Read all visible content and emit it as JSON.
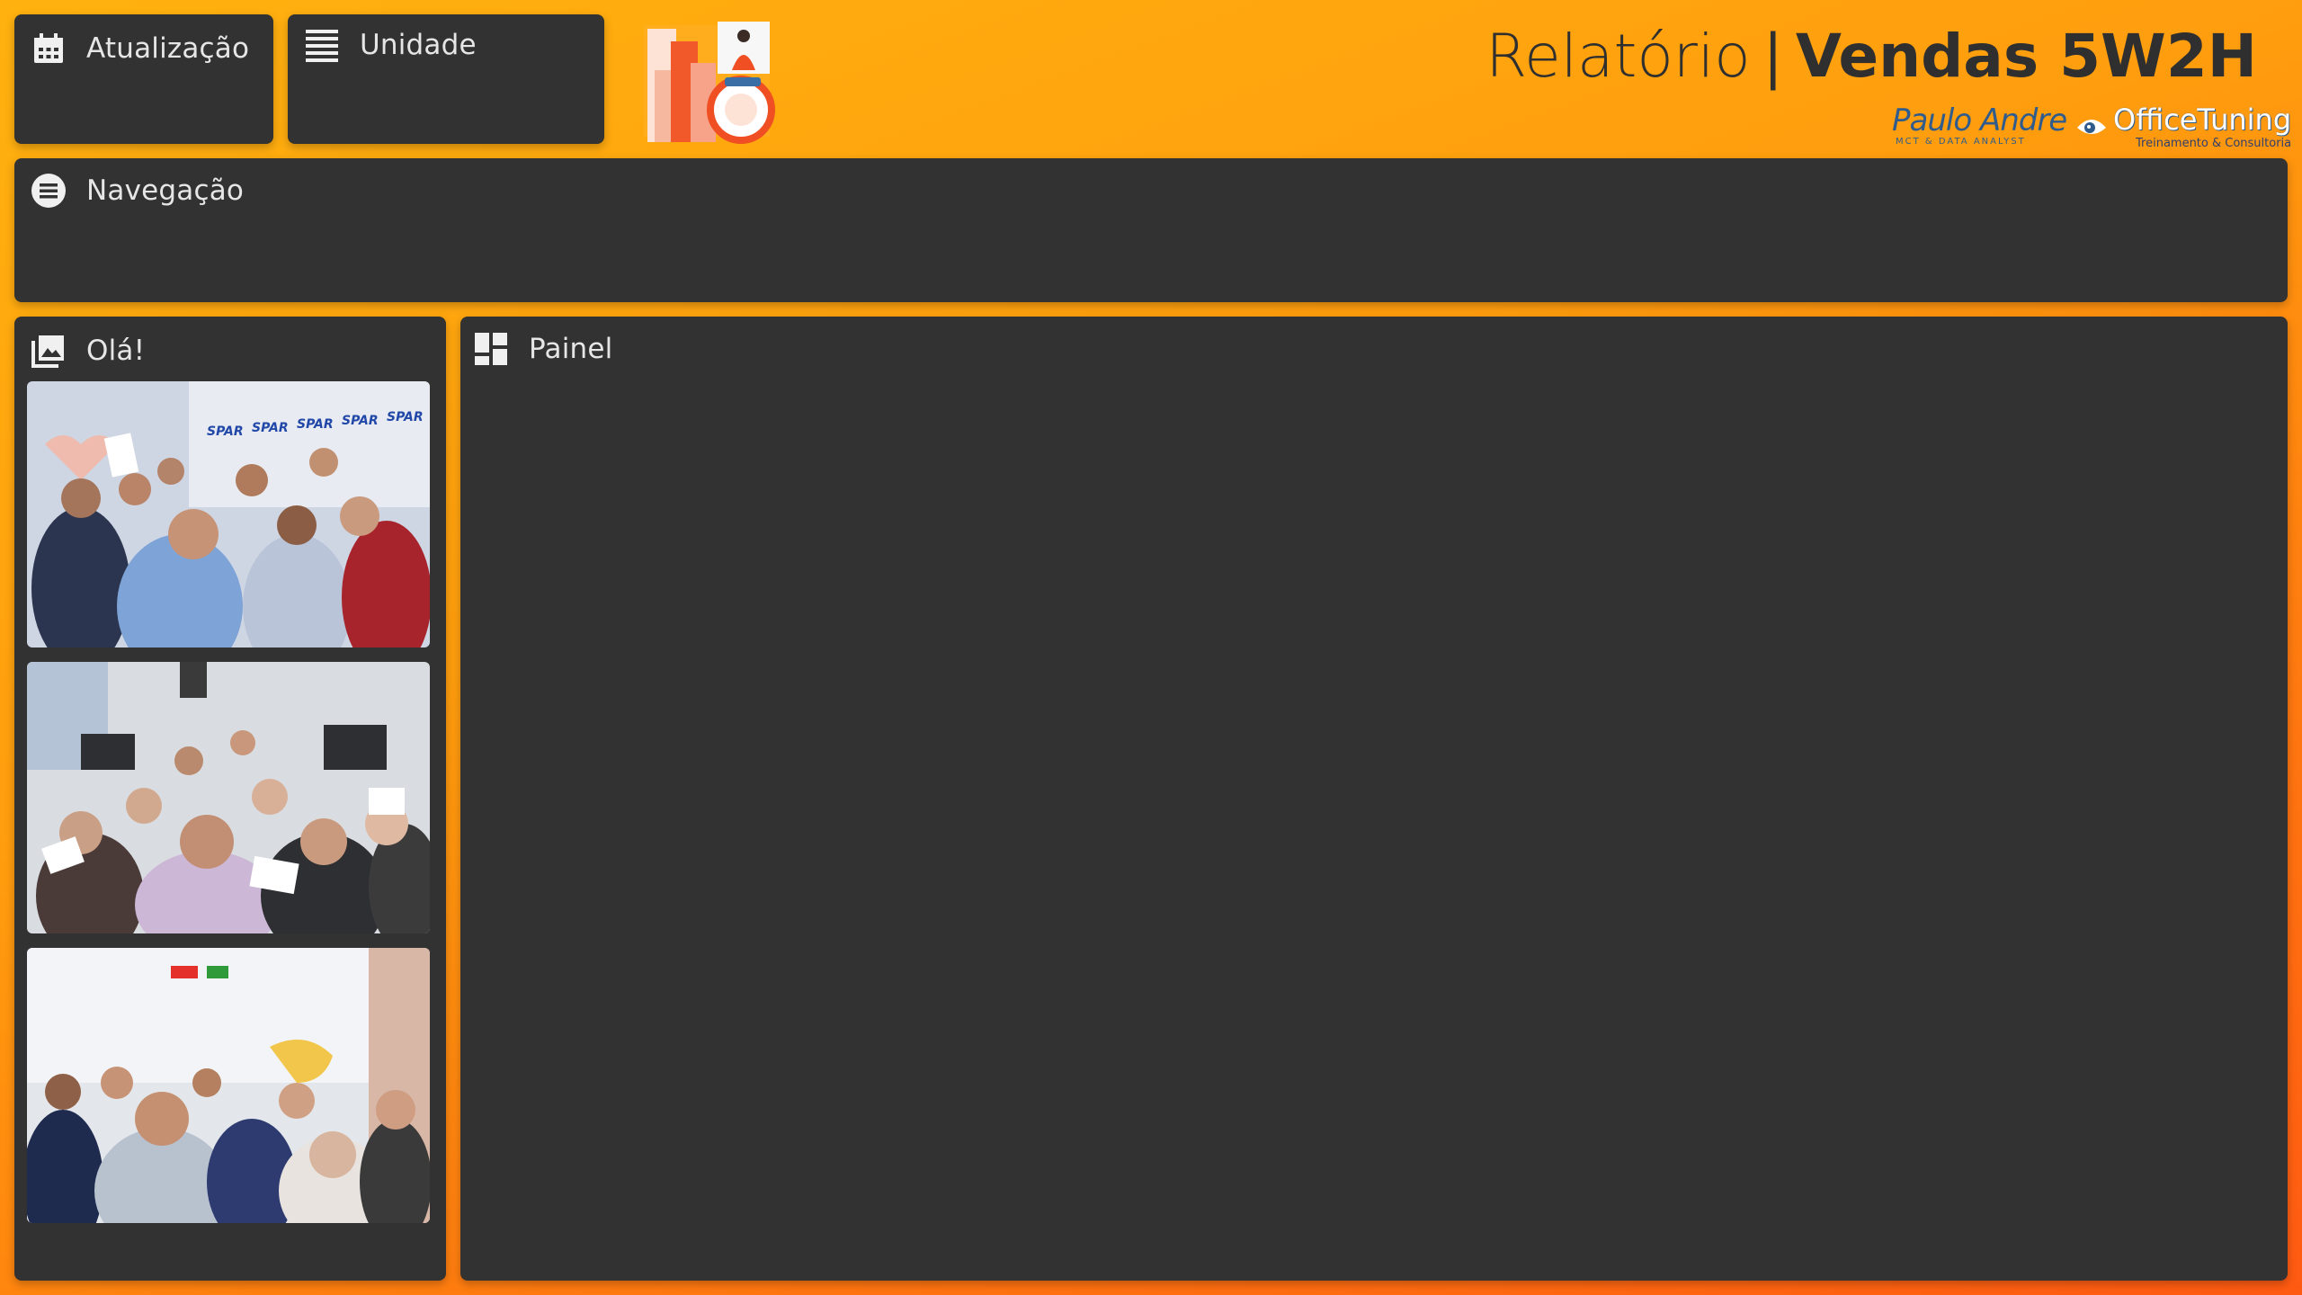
{
  "header": {
    "title_light": "Relatório",
    "title_sep": "|",
    "title_bold": "Vendas 5W2H",
    "signature_name": "Paulo Andre",
    "signature_sub": "MCT & DATA ANALYST",
    "brand_name": "OfficeTuning",
    "brand_sub": "Treinamento & Consultoria"
  },
  "cards": {
    "atualizacao": {
      "label": "Atualização",
      "icon": "calendar-icon"
    },
    "unidade": {
      "label": "Unidade",
      "icon": "list-lines-icon"
    },
    "navegacao": {
      "label": "Navegação",
      "icon": "menu-circle-icon"
    },
    "ola": {
      "label": "Olá!",
      "icon": "image-gallery-icon"
    },
    "painel": {
      "label": "Painel",
      "icon": "dashboard-icon"
    }
  },
  "photos": [
    {
      "name": "group-photo-1"
    },
    {
      "name": "group-photo-2"
    },
    {
      "name": "group-photo-3"
    }
  ],
  "colors": {
    "accent_orange": "#ff9d0e",
    "card_bg": "#323232",
    "label_text": "#e6e6e6",
    "title_text": "#2f2f2f"
  }
}
